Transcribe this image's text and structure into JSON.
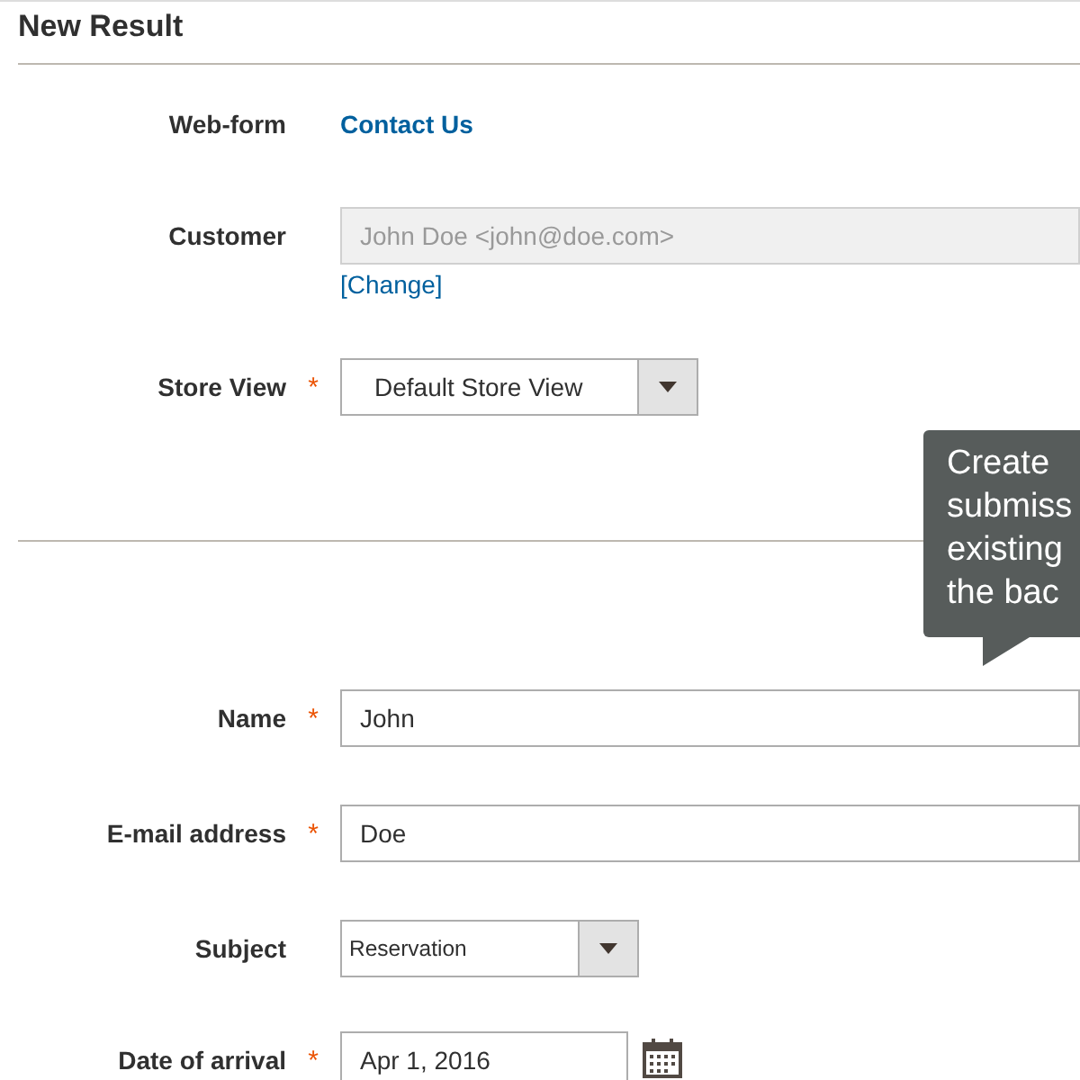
{
  "title": "New Result",
  "sections": [
    {
      "fields": [
        {
          "kind": "link",
          "label": "Web-form",
          "value": "Contact Us"
        },
        {
          "kind": "readonly",
          "label": "Customer",
          "value": "John Doe <john@doe.com>",
          "disabled": true,
          "action": "[Change]"
        },
        {
          "kind": "select",
          "label": "Store View",
          "required_mark": "*",
          "value": "Default Store View"
        }
      ]
    },
    {
      "fields": [
        {
          "kind": "text",
          "label": "Name",
          "required_mark": "*",
          "value": "John"
        },
        {
          "kind": "text",
          "label": "E-mail address",
          "required_mark": "*",
          "value": "Doe"
        },
        {
          "kind": "select-small",
          "label": "Subject",
          "value": "Reservation"
        },
        {
          "kind": "date",
          "label": "Date of arrival",
          "required_mark": "*",
          "value": "Apr 1, 2016"
        }
      ]
    }
  ],
  "tooltip": {
    "lines": [
      "Create",
      "submiss",
      "existing",
      "the bac"
    ]
  }
}
